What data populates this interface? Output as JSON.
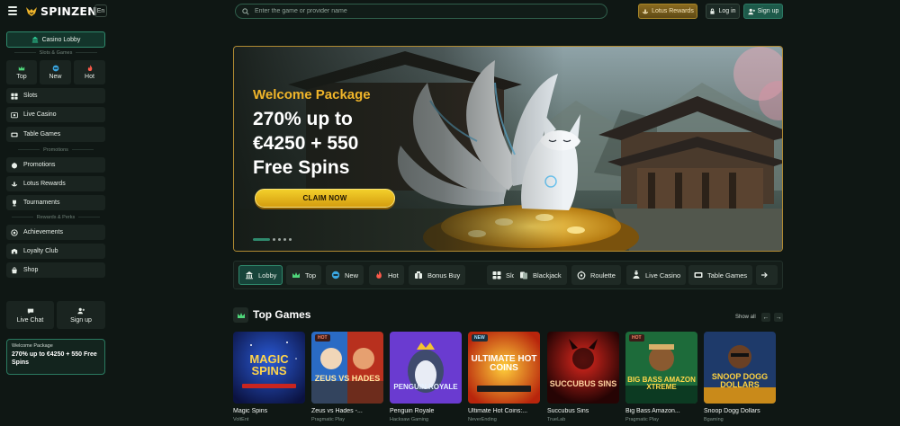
{
  "header": {
    "brand": "SPINZEN",
    "language": "En",
    "search_placeholder": "Enter the game or provider name",
    "lotus_rewards": "Lotus Rewards",
    "login": "Log in",
    "signup": "Sign up"
  },
  "sidebar": {
    "lobby": "Casino Lobby",
    "section_slots": "Slots & Games",
    "quick": [
      {
        "label": "Top",
        "icon": "crown-icon"
      },
      {
        "label": "New",
        "icon": "new-badge-icon"
      },
      {
        "label": "Hot",
        "icon": "flame-icon"
      }
    ],
    "games": [
      {
        "label": "Slots",
        "icon": "slots-icon"
      },
      {
        "label": "Live Casino",
        "icon": "live-casino-icon"
      },
      {
        "label": "Table Games",
        "icon": "cards-icon"
      }
    ],
    "section_promotions": "Promotions",
    "promos": [
      {
        "label": "Promotions",
        "icon": "gift-icon"
      },
      {
        "label": "Lotus Rewards",
        "icon": "lotus-icon"
      },
      {
        "label": "Tournaments",
        "icon": "trophy-icon"
      }
    ],
    "section_rewards": "Rewards & Perks",
    "rewards": [
      {
        "label": "Achievements",
        "icon": "medal-icon"
      },
      {
        "label": "Loyalty Club",
        "icon": "loyalty-icon"
      },
      {
        "label": "Shop",
        "icon": "shop-icon"
      }
    ],
    "live_chat": "Live Chat",
    "sign_up": "Sign up",
    "welcome_card": {
      "title": "Welcome Package",
      "offer": "270% up to €4250 + 550 Free Spins"
    }
  },
  "hero": {
    "subtitle": "Welcome Package",
    "title": "270% up to\n€4250 + 550\nFree Spins",
    "cta": "CLAIM NOW",
    "slides_total": 5,
    "slide_active": 1
  },
  "categories": [
    {
      "label": "Lobby",
      "icon": "lobby-icon",
      "active": true
    },
    {
      "label": "Top",
      "icon": "crown-icon"
    },
    {
      "label": "New",
      "icon": "new-badge-icon"
    },
    {
      "label": "Hot",
      "icon": "flame-icon"
    },
    {
      "label": "Bonus Buy",
      "icon": "bonus-buy-icon"
    },
    {
      "label": "Slots",
      "icon": "slots-icon"
    },
    {
      "label": "Blackjack",
      "icon": "blackjack-icon"
    },
    {
      "label": "Roulette",
      "icon": "roulette-icon"
    },
    {
      "label": "Live Casino",
      "icon": "live-casino-icon"
    },
    {
      "label": "Table Games",
      "icon": "table-games-icon"
    }
  ],
  "top_games": {
    "title": "Top Games",
    "show_all": "Show all",
    "games": [
      {
        "name": "Magic Spins",
        "provider": "VoltEnt",
        "badge": "",
        "art": "MAGIC SPINS"
      },
      {
        "name": "Zeus vs Hades -...",
        "provider": "Pragmatic Play",
        "badge": "HOT",
        "art": "ZEUS VS HADES"
      },
      {
        "name": "Penguin Royale",
        "provider": "Hacksaw Gaming",
        "badge": "",
        "art": "PENGUIN ROYALE"
      },
      {
        "name": "Ultimate Hot Coins:...",
        "provider": "NeverEnding",
        "badge": "NEW",
        "art": "ULTIMATE HOT COINS"
      },
      {
        "name": "Succubus Sins",
        "provider": "TrueLab",
        "badge": "",
        "art": "SUCCUBUS SINS"
      },
      {
        "name": "Big Bass Amazon...",
        "provider": "Pragmatic Play",
        "badge": "HOT",
        "art": "BIG BASS AMAZON XTREME"
      },
      {
        "name": "Snoop Dogg Dollars",
        "provider": "Bgaming",
        "badge": "",
        "art": "SNOOP DOGG DOLLARS"
      }
    ]
  },
  "colors": {
    "background": "#0f1714",
    "accent_green": "#2f8a6d",
    "gold": "#f0b52a"
  }
}
